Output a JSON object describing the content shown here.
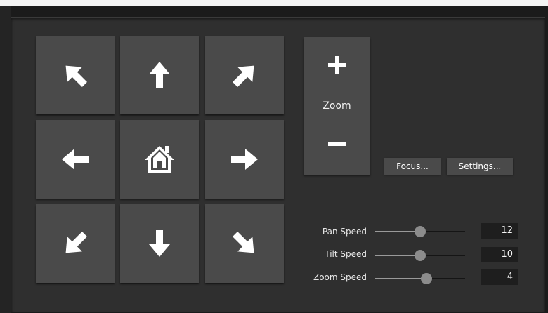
{
  "ptz": {
    "direction_buttons": [
      {
        "name": "up-left",
        "icon": "arrow-up-left-icon"
      },
      {
        "name": "up",
        "icon": "arrow-up-icon"
      },
      {
        "name": "up-right",
        "icon": "arrow-up-right-icon"
      },
      {
        "name": "left",
        "icon": "arrow-left-icon"
      },
      {
        "name": "home",
        "icon": "home-icon"
      },
      {
        "name": "right",
        "icon": "arrow-right-icon"
      },
      {
        "name": "down-left",
        "icon": "arrow-down-left-icon"
      },
      {
        "name": "down",
        "icon": "arrow-down-icon"
      },
      {
        "name": "down-right",
        "icon": "arrow-down-right-icon"
      }
    ]
  },
  "zoom": {
    "label": "Zoom",
    "in_icon": "plus-icon",
    "out_icon": "minus-icon"
  },
  "buttons": {
    "focus_label": "Focus...",
    "settings_label": "Settings..."
  },
  "speeds": [
    {
      "label": "Pan Speed",
      "value": "12",
      "level": 0.5
    },
    {
      "label": "Tilt Speed",
      "value": "10",
      "level": 0.5
    },
    {
      "label": "Zoom Speed",
      "value": "4",
      "level": 0.57
    }
  ],
  "colors": {
    "panel": "#2f2f2f",
    "button": "#4a4a4a",
    "icon": "#ffffff"
  }
}
